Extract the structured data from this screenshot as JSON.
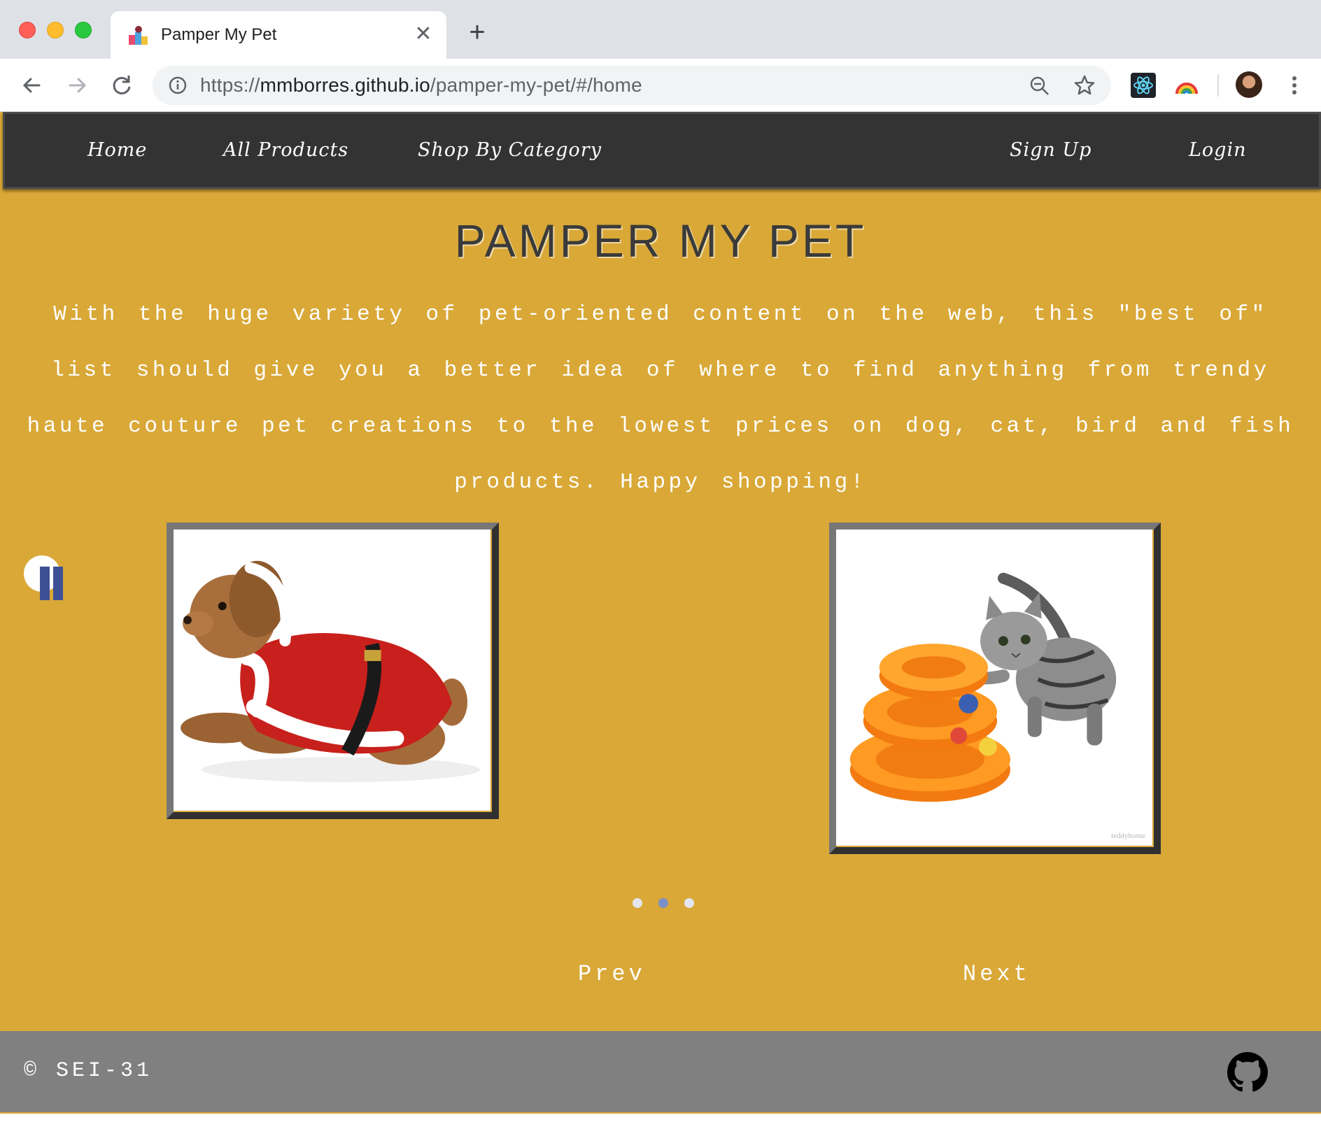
{
  "browser": {
    "tab_title": "Pamper My Pet",
    "close_glyph": "✕",
    "new_tab_glyph": "+",
    "url_scheme": "https://",
    "url_host": "mmborres.github.io",
    "url_path": "/pamper-my-pet/#/home",
    "icons": [
      "back-icon",
      "forward-icon",
      "reload-icon",
      "info-icon",
      "zoom-out-icon",
      "bookmark-star-icon",
      "react-devtools-icon",
      "rainbow-extension-icon",
      "profile-avatar",
      "menu-dots-icon"
    ]
  },
  "nav": {
    "home": "Home",
    "all_products": "All Products",
    "shop_by_category": "Shop By Category",
    "sign_up": "Sign Up",
    "login": "Login"
  },
  "hero": {
    "title": "PAMPER MY PET",
    "description": "With the huge variety of pet-oriented content on the web, this \"best of\" list should give you a better idea of where to find anything from trendy haute couture pet creations to the lowest prices on dog, cat, bird and fish products. Happy shopping!"
  },
  "carousel": {
    "slides": [
      "dog-santa-costume",
      "cat-tower-toy"
    ],
    "watermark": "teddyhome",
    "active_dot": 1,
    "dot_count": 3,
    "prev_label": "Prev",
    "next_label": "Next",
    "colors": {
      "dot_active": "#7b8fc7",
      "dot_inactive": "#e3e6f0",
      "pause": "#3f4f95"
    }
  },
  "footer": {
    "copyright": "© SEI-31",
    "icon": "github-icon"
  },
  "colors": {
    "page_bg": "#d9a837",
    "navbar_bg": "#333333",
    "footer_bg": "#808080"
  }
}
